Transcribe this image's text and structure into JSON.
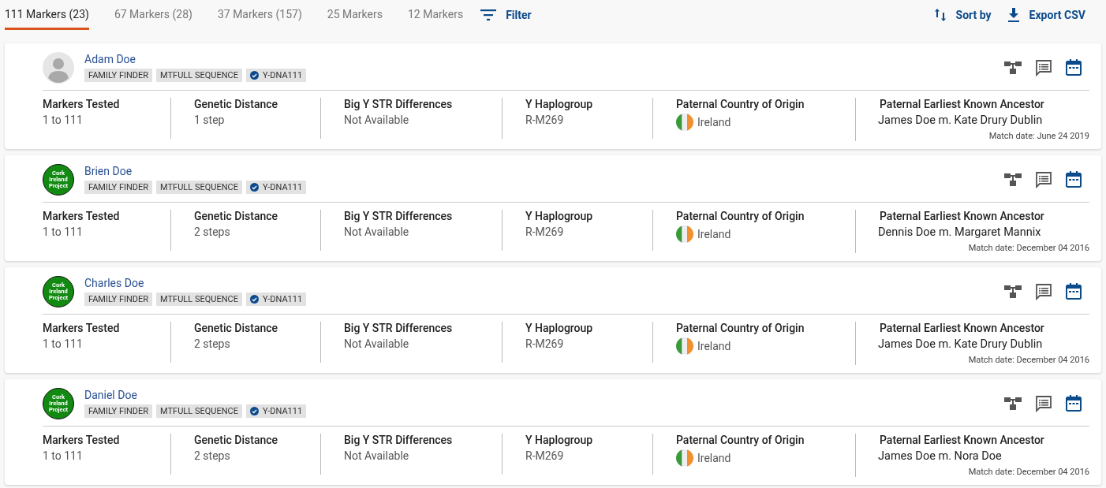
{
  "tabs": [
    {
      "label": "111 Markers (23)",
      "selected": true
    },
    {
      "label": "67 Markers (28)",
      "selected": false
    },
    {
      "label": "37 Markers (157)",
      "selected": false
    },
    {
      "label": "25 Markers",
      "selected": false
    },
    {
      "label": "12 Markers",
      "selected": false
    }
  ],
  "toolbar": {
    "filter": "Filter",
    "sort": "Sort by",
    "export": "Export CSV"
  },
  "matches": [
    {
      "name": "Adam Doe",
      "avatar": {
        "kind": "silhouette"
      },
      "tags": [
        {
          "label": "FAMILY FINDER",
          "verified": false
        },
        {
          "label": "MTFULL SEQUENCE",
          "verified": false
        },
        {
          "label": "Y-DNA111",
          "verified": true
        }
      ],
      "fields": [
        {
          "label": "Markers Tested",
          "value": "1 to 111"
        },
        {
          "label": "Genetic Distance",
          "value": "1 step"
        },
        {
          "label": "Big Y STR Differences",
          "value": "Not Available"
        },
        {
          "label": "Y Haplogroup",
          "value": "R-M269"
        },
        {
          "label": "Paternal Country of Origin",
          "value": "Ireland",
          "kind": "country"
        },
        {
          "label": "Paternal Earliest Known Ancestor",
          "value": "James Doe m. Kate Drury Dublin",
          "kind": "ancestor"
        }
      ],
      "match_date": "Match date: June 24 2019"
    },
    {
      "name": "Brien Doe",
      "avatar": {
        "kind": "logo",
        "lines": [
          "Cork",
          "Ireland",
          "Project"
        ]
      },
      "tags": [
        {
          "label": "FAMILY FINDER",
          "verified": false
        },
        {
          "label": "MTFULL SEQUENCE",
          "verified": false
        },
        {
          "label": "Y-DNA111",
          "verified": true
        }
      ],
      "fields": [
        {
          "label": "Markers Tested",
          "value": "1 to 111"
        },
        {
          "label": "Genetic Distance",
          "value": "2 steps"
        },
        {
          "label": "Big Y STR Differences",
          "value": "Not Available"
        },
        {
          "label": "Y Haplogroup",
          "value": "R-M269"
        },
        {
          "label": "Paternal Country of Origin",
          "value": "Ireland",
          "kind": "country"
        },
        {
          "label": "Paternal Earliest Known Ancestor",
          "value": "Dennis Doe m. Margaret Mannix",
          "kind": "ancestor"
        }
      ],
      "match_date": "Match date: December 04 2016"
    },
    {
      "name": "Charles Doe",
      "avatar": {
        "kind": "logo",
        "lines": [
          "Cork",
          "Ireland",
          "Project"
        ]
      },
      "tags": [
        {
          "label": "FAMILY FINDER",
          "verified": false
        },
        {
          "label": "MTFULL SEQUENCE",
          "verified": false
        },
        {
          "label": "Y-DNA111",
          "verified": true
        }
      ],
      "fields": [
        {
          "label": "Markers Tested",
          "value": "1 to 111"
        },
        {
          "label": "Genetic Distance",
          "value": "2 steps"
        },
        {
          "label": "Big Y STR Differences",
          "value": "Not Available"
        },
        {
          "label": "Y Haplogroup",
          "value": "R-M269"
        },
        {
          "label": "Paternal Country of Origin",
          "value": "Ireland",
          "kind": "country"
        },
        {
          "label": "Paternal Earliest Known Ancestor",
          "value": "James Doe m. Kate Drury Dublin",
          "kind": "ancestor"
        }
      ],
      "match_date": "Match date: December 04 2016"
    },
    {
      "name": "Daniel Doe",
      "avatar": {
        "kind": "logo",
        "lines": [
          "Cork",
          "Ireland",
          "Project"
        ]
      },
      "tags": [
        {
          "label": "FAMILY FINDER",
          "verified": false
        },
        {
          "label": "MTFULL SEQUENCE",
          "verified": false
        },
        {
          "label": "Y-DNA111",
          "verified": true
        }
      ],
      "fields": [
        {
          "label": "Markers Tested",
          "value": "1 to 111"
        },
        {
          "label": "Genetic Distance",
          "value": "2 steps"
        },
        {
          "label": "Big Y STR Differences",
          "value": "Not Available"
        },
        {
          "label": "Y Haplogroup",
          "value": "R-M269"
        },
        {
          "label": "Paternal Country of Origin",
          "value": "Ireland",
          "kind": "country"
        },
        {
          "label": "Paternal Earliest Known Ancestor",
          "value": "James Doe m. Nora Doe",
          "kind": "ancestor"
        }
      ],
      "match_date": "Match date: December 04 2016"
    }
  ]
}
